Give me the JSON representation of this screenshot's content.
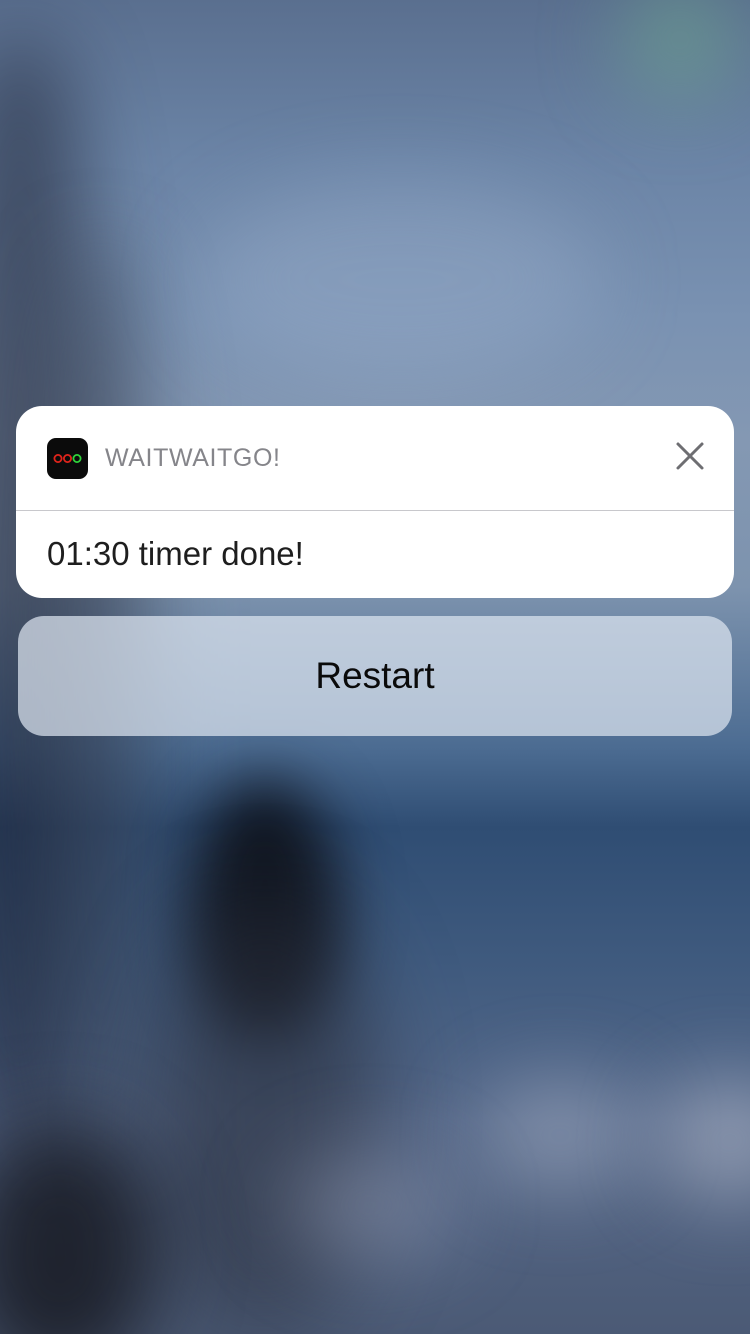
{
  "notification": {
    "app_name": "WAITWAITGO!",
    "app_icon": "traffic-light-icon",
    "message": "01:30 timer done!",
    "close_icon": "close-icon",
    "icon_colors": {
      "background": "#0b0b0b",
      "red": "#e0241b",
      "green": "#2fd33a"
    }
  },
  "actions": {
    "restart_label": "Restart"
  }
}
